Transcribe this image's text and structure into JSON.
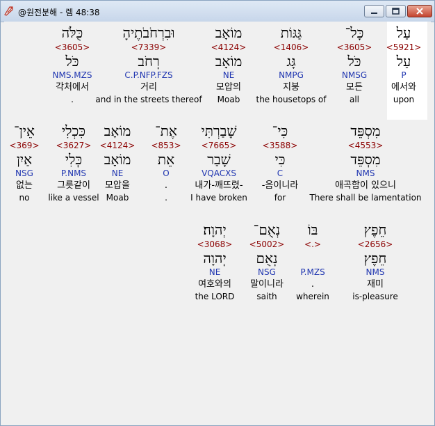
{
  "window": {
    "title": "@원전분해 - 렘 48:38"
  },
  "rows": [
    [
      {
        "heb": "עַל",
        "strong": "<5921>",
        "lex": "עַל",
        "morph": "P",
        "kor": "에서와",
        "eng": "upon"
      },
      {
        "heb": "כָּל־",
        "strong": "<3605>",
        "lex": "כֹּל",
        "morph": "NMSG",
        "kor": "모든",
        "eng": "all"
      },
      {
        "heb": "גַּגּוֹת",
        "strong": "<1406>",
        "lex": "גָּג",
        "morph": "NMPG",
        "kor": "지붕",
        "eng": "the housetops of"
      },
      {
        "heb": "מוֹאָב",
        "strong": "<4124>",
        "lex": "מוֹאָב",
        "morph": "NE",
        "kor": "모압의",
        "eng": "Moab"
      },
      {
        "heb": "וּבִרְחֹבֹתֶיהָ",
        "strong": "<7339>",
        "lex": "רְחֹב",
        "morph": "C.P.NFP.FZS",
        "kor": "거리",
        "eng": "and in the streets thereof"
      },
      {
        "heb": "כֻּלֹּה",
        "strong": "<3605>",
        "lex": "כֹּל",
        "morph": "NMS.MZS",
        "kor": "각처에서",
        "eng": "."
      }
    ],
    [
      {
        "heb": "מִסְפֵּד",
        "strong": "<4553>",
        "lex": "מִסְפֵּד",
        "morph": "NMS",
        "kor": "애곡함이 있으니",
        "eng": "There shall be lamentation"
      },
      {
        "heb": "כִּי־",
        "strong": "<3588>",
        "lex": "כִּי",
        "morph": "C",
        "kor": "-음이니라",
        "eng": "for"
      },
      {
        "heb": "שָׁבַרְתִּי",
        "strong": "<7665>",
        "lex": "שָׁבַר",
        "morph": "VQACXS",
        "kor": "내가-깨뜨렸-",
        "eng": "I have broken"
      },
      {
        "heb": "אֶת־",
        "strong": "<853>",
        "lex": "אֵת",
        "morph": "O",
        "kor": ".",
        "eng": "."
      },
      {
        "heb": "מוֹאָב",
        "strong": "<4124>",
        "lex": "מוֹאָב",
        "morph": "NE",
        "kor": "모압을",
        "eng": "Moab"
      },
      {
        "heb": "כִּכְלִי",
        "strong": "<3627>",
        "lex": "כְּלִי",
        "morph": "P.NMS",
        "kor": "그릇같이",
        "eng": "like a vessel"
      },
      {
        "heb": "אֵין־",
        "strong": "<369>",
        "lex": "אַיִן",
        "morph": "NSG",
        "kor": "없는",
        "eng": "no"
      }
    ],
    [
      {
        "heb": "חֵפֶץ",
        "strong": "<2656>",
        "lex": "חֵפֶץ",
        "morph": "NMS",
        "kor": "재미",
        "eng": "is-pleasure"
      },
      {
        "heb": "בּוֹ",
        "strong": "<.>",
        "lex": "",
        "morph": "P.MZS",
        "kor": ".",
        "eng": "wherein"
      },
      {
        "heb": "נְאֻם־",
        "strong": "<5002>",
        "lex": "נְאֻם",
        "morph": "NSG",
        "kor": "말이니라",
        "eng": "saith"
      },
      {
        "heb": "יְהוָה׃",
        "strong": "<3068>",
        "lex": "יְהוָה",
        "morph": "NE",
        "kor": "여호와의",
        "eng": "the LORD"
      }
    ]
  ],
  "colors": {
    "strong": "#8b0000",
    "morph": "#1f35b0",
    "highlight": "#ffffff"
  }
}
